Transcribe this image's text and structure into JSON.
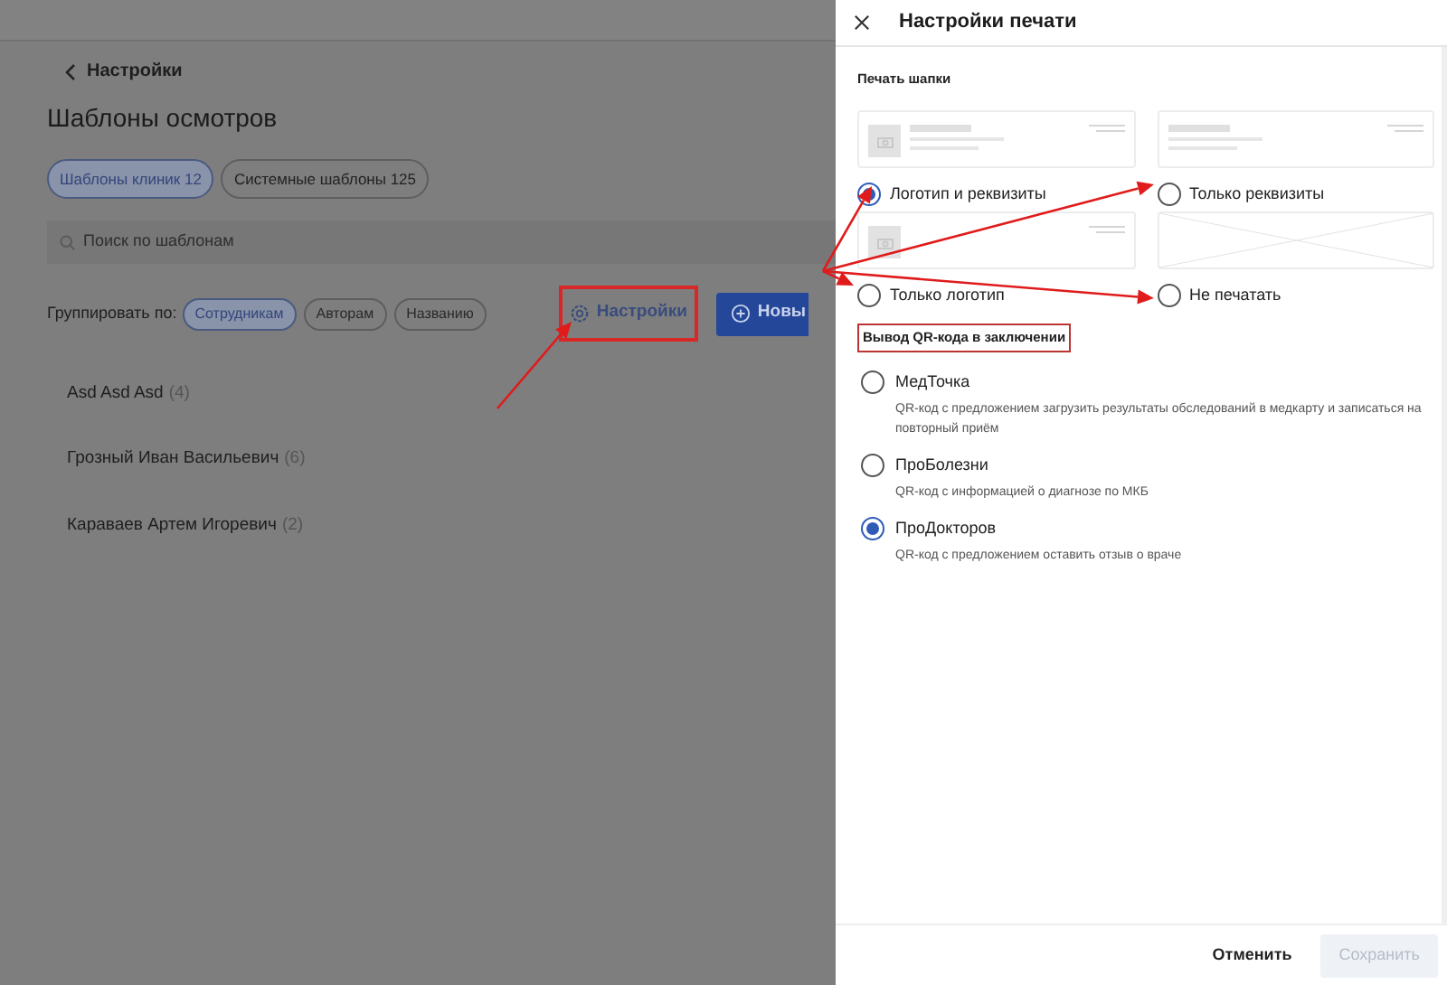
{
  "page": {
    "back_link": "Настройки",
    "title": "Шаблоны осмотров",
    "tabs": [
      {
        "label": "Шаблоны клиник 12",
        "selected": true
      },
      {
        "label": "Системные шаблоны 125",
        "selected": false
      }
    ],
    "search": {
      "placeholder": "Поиск по шаблонам"
    },
    "group_by": {
      "label": "Группировать по:",
      "options": [
        {
          "label": "Сотрудникам",
          "selected": true
        },
        {
          "label": "Авторам",
          "selected": false
        },
        {
          "label": "Названию",
          "selected": false
        }
      ]
    },
    "settings_button": "Настройки",
    "new_button": "Новы",
    "groups": [
      {
        "name": "Asd Asd Asd",
        "count": "(4)"
      },
      {
        "name": "Грозный Иван Васильевич",
        "count": "(6)"
      },
      {
        "name": "Караваев Артем Игоревич",
        "count": "(2)"
      }
    ]
  },
  "drawer": {
    "title": "Настройки печати",
    "header_print": {
      "heading": "Печать шапки",
      "options": [
        {
          "kind": "logo_details",
          "label": "Логотип и реквизиты",
          "selected": true
        },
        {
          "kind": "details",
          "label": "Только реквизиты",
          "selected": false
        },
        {
          "kind": "logo",
          "label": "Только логотип",
          "selected": false
        },
        {
          "kind": "none",
          "label": "Не печатать",
          "selected": false
        }
      ]
    },
    "qr": {
      "heading": "Вывод QR-кода в заключении",
      "options": [
        {
          "label": "МедТочка",
          "description": "QR-код с предложением загрузить результаты обследований в медкарту и записаться на повторный приём",
          "selected": false
        },
        {
          "label": "ПроБолезни",
          "description": "QR-код с информацией о диагнозе по МКБ",
          "selected": false
        },
        {
          "label": "ПроДокторов",
          "description": "QR-код с предложением оставить отзыв о враче",
          "selected": true
        }
      ]
    },
    "cancel_button": {
      "label": "Отменить",
      "disabled": false
    },
    "save_button": {
      "label": "Сохранить",
      "disabled": true
    }
  }
}
